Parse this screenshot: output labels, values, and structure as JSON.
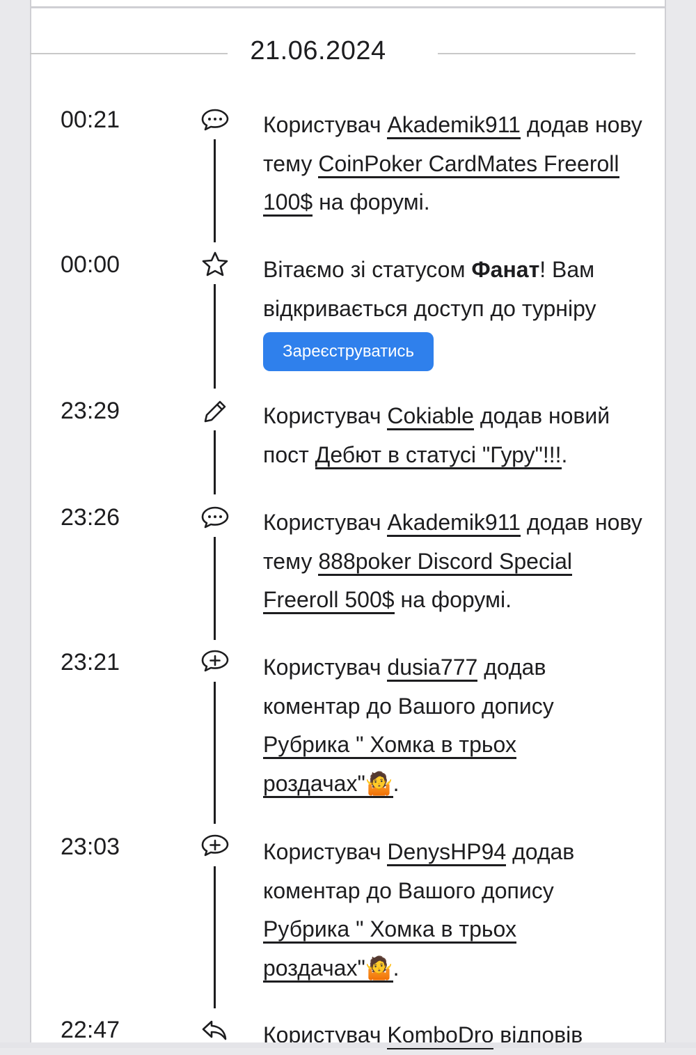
{
  "date": "21.06.2024",
  "entries": [
    {
      "time": "00:21",
      "icon": "comment-dots-icon",
      "parts": [
        {
          "t": "Користувач "
        },
        {
          "t": "Akademik911",
          "link": true
        },
        {
          "t": " додав нову тему "
        },
        {
          "t": "CoinPoker CardMates Freeroll 100$",
          "link": true
        },
        {
          "t": " на форумі."
        }
      ]
    },
    {
      "time": "00:00",
      "icon": "star-icon",
      "parts": [
        {
          "t": "Вітаємо зі статусом "
        },
        {
          "t": "Фанат",
          "bold": true
        },
        {
          "t": "! Вам відкривається доступ до турніру"
        }
      ],
      "button": "Зареєструватись"
    },
    {
      "time": "23:29",
      "icon": "pencil-icon",
      "parts": [
        {
          "t": "Користувач "
        },
        {
          "t": "Cokiable",
          "link": true
        },
        {
          "t": " додав новий пост "
        },
        {
          "t": "Дебют в статусі \"Гуру\"!!!",
          "link": true
        },
        {
          "t": "."
        }
      ]
    },
    {
      "time": "23:26",
      "icon": "comment-dots-icon",
      "parts": [
        {
          "t": "Користувач "
        },
        {
          "t": "Akademik911",
          "link": true
        },
        {
          "t": " додав нову тему "
        },
        {
          "t": "888poker Discord Special Freeroll 500$",
          "link": true
        },
        {
          "t": " на форумі."
        }
      ]
    },
    {
      "time": "23:21",
      "icon": "comment-plus-icon",
      "parts": [
        {
          "t": "Користувач "
        },
        {
          "t": "dusia777",
          "link": true
        },
        {
          "t": " додав коментар до Вашого допису "
        },
        {
          "t": "Рубрика \" Хомка в трьох роздачах\"🤷",
          "link": true
        },
        {
          "t": "."
        }
      ]
    },
    {
      "time": "23:03",
      "icon": "comment-plus-icon",
      "parts": [
        {
          "t": "Користувач "
        },
        {
          "t": "DenysHP94",
          "link": true
        },
        {
          "t": " додав коментар до Вашого допису "
        },
        {
          "t": "Рубрика \" Хомка в трьох роздачах\"🤷",
          "link": true
        },
        {
          "t": "."
        }
      ]
    },
    {
      "time": "22:47",
      "icon": "reply-icon",
      "parts": [
        {
          "t": "Користувач "
        },
        {
          "t": "KomboDro",
          "link": true
        },
        {
          "t": " відповів"
        }
      ]
    }
  ]
}
